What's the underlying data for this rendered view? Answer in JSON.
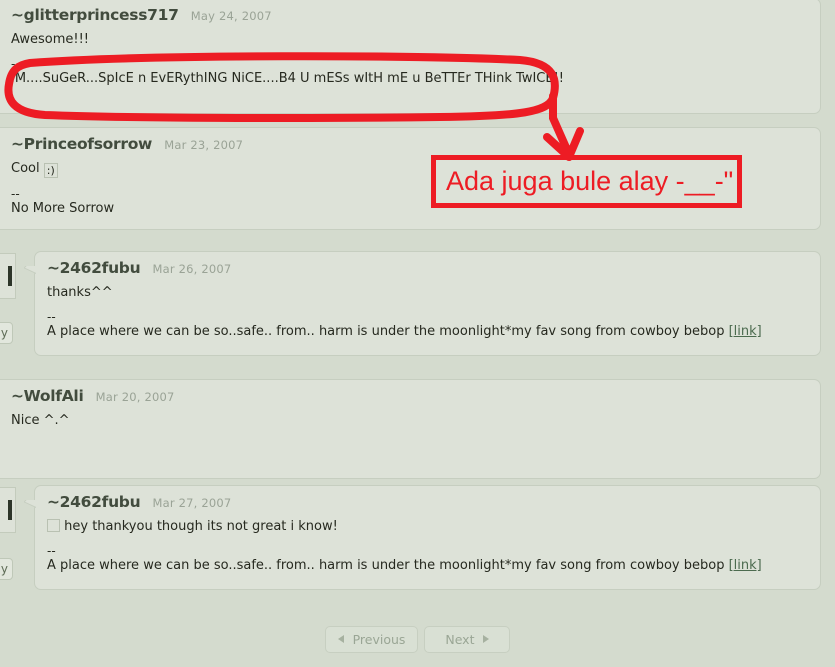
{
  "page": {
    "background_color": "#d4dbce",
    "bubble_color": "#dde2d8",
    "annotation_color": "#ed1c24"
  },
  "comments": [
    {
      "username": "~glitterprincess717",
      "date": "May 24, 2007",
      "body": "Awesome!!!",
      "sig_dash": "--",
      "signature": "IM....SuGeR...SpIcE n EvERythING NiCE....B4 U mESs wItH mE u BeTTEr THink TwICE!!",
      "link_label": ""
    },
    {
      "username": "~Princeofsorrow",
      "date": "Mar 23, 2007",
      "body": "Cool",
      "emoticon_alt": ":)",
      "sig_dash": "--",
      "signature": "No More Sorrow",
      "link_label": ""
    },
    {
      "username": "~2462fubu",
      "date": "Mar 26, 2007",
      "body": "thanks^^",
      "sig_dash": "--",
      "signature": "A place where we can be so..safe.. from.. harm is under the moonlight*my fav song from cowboy bebop",
      "link_label": "[link]",
      "reply_label": "ly"
    },
    {
      "username": "~WolfAli",
      "date": "Mar 20, 2007",
      "body": "Nice ^.^",
      "sig_dash": "",
      "signature": "",
      "link_label": ""
    },
    {
      "username": "~2462fubu",
      "date": "Mar 27, 2007",
      "body": "hey thankyou though its not great i know!",
      "sig_dash": "--",
      "signature": "A place where we can be so..safe.. from.. harm is under the moonlight*my fav song from cowboy bebop",
      "link_label": "[link]",
      "reply_label": "ly"
    }
  ],
  "pagination": {
    "previous_label": "Previous",
    "next_label": "Next"
  },
  "annotation": {
    "text": "Ada juga bule alay -__-\""
  }
}
